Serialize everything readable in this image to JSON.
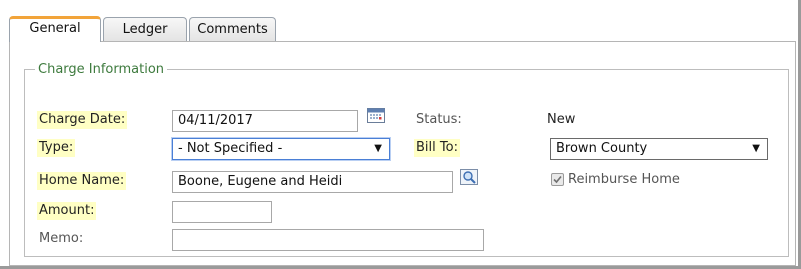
{
  "tabs": [
    {
      "label": "General",
      "active": true
    },
    {
      "label": "Ledger",
      "active": false
    },
    {
      "label": "Comments",
      "active": false
    }
  ],
  "section": {
    "legend": "Charge Information"
  },
  "form": {
    "charge_date": {
      "label": "Charge Date:",
      "value": "04/11/2017",
      "icon": "calendar-icon"
    },
    "status": {
      "label": "Status:",
      "value": "New"
    },
    "type": {
      "label": "Type:",
      "value": "- Not Specified -"
    },
    "bill_to": {
      "label": "Bill To:",
      "value": "Brown County"
    },
    "home_name": {
      "label": "Home Name:",
      "value": "Boone, Eugene and Heidi",
      "icon": "lookup-icon"
    },
    "reimburse_home": {
      "label": "Reimburse Home",
      "checked": true,
      "disabled": true
    },
    "amount": {
      "label": "Amount:",
      "value": ""
    },
    "memo": {
      "label": "Memo:",
      "value": ""
    }
  },
  "colors": {
    "required_bg": "#ffffc4",
    "active_tab_accent": "#f2a43a",
    "legend": "#3d7a3d"
  }
}
